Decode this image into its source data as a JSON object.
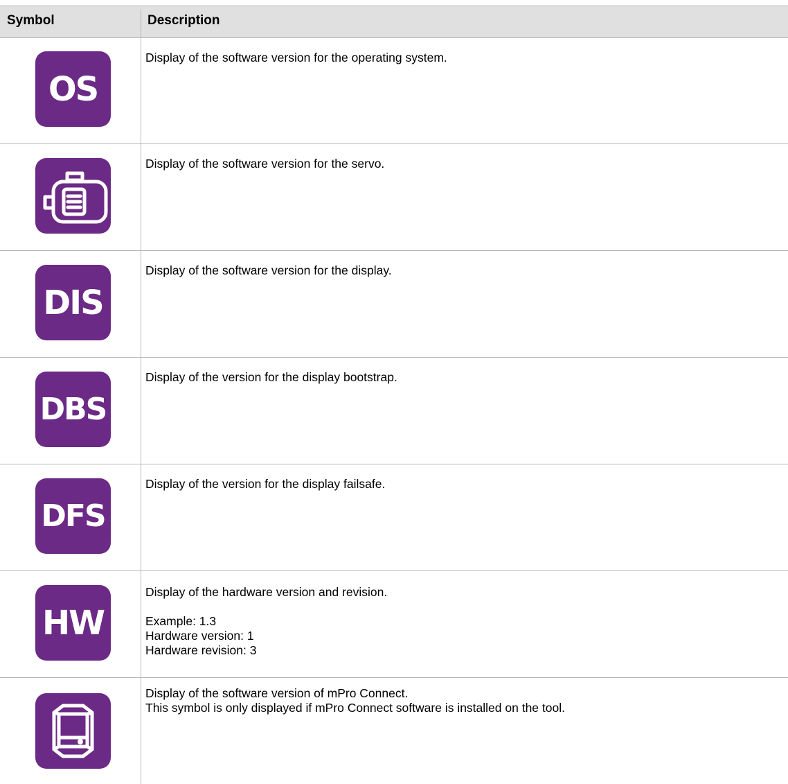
{
  "table": {
    "headers": {
      "symbol": "Symbol",
      "description": "Description"
    },
    "rows": [
      {
        "icon": "OS",
        "icon_name": "os-icon",
        "lines": [
          "Display of the software version for the operating system."
        ]
      },
      {
        "icon": "",
        "icon_name": "servo-motor-icon",
        "lines": [
          "Display of the software version for the servo."
        ]
      },
      {
        "icon": "DIS",
        "icon_name": "dis-icon",
        "lines": [
          "Display of the software version for the display."
        ]
      },
      {
        "icon": "DBS",
        "icon_name": "dbs-icon",
        "lines": [
          "Display of the version for the display bootstrap."
        ]
      },
      {
        "icon": "DFS",
        "icon_name": "dfs-icon",
        "lines": [
          "Display of the version for the display failsafe."
        ]
      },
      {
        "icon": "HW",
        "icon_name": "hw-icon",
        "lines": [
          "Display of the hardware version and revision.",
          "",
          "Example: 1.3",
          "Hardware version: 1",
          "Hardware revision: 3"
        ]
      },
      {
        "icon": "",
        "icon_name": "mpro-connect-device-icon",
        "lines": [
          "Display of the software version of mPro Connect.",
          "This symbol  is only displayed if mPro Connect software is installed on the tool."
        ]
      }
    ]
  },
  "colors": {
    "icon_bg": "#6b2a86",
    "header_bg": "#e0e0e0",
    "grid": "#b7b7b7"
  }
}
